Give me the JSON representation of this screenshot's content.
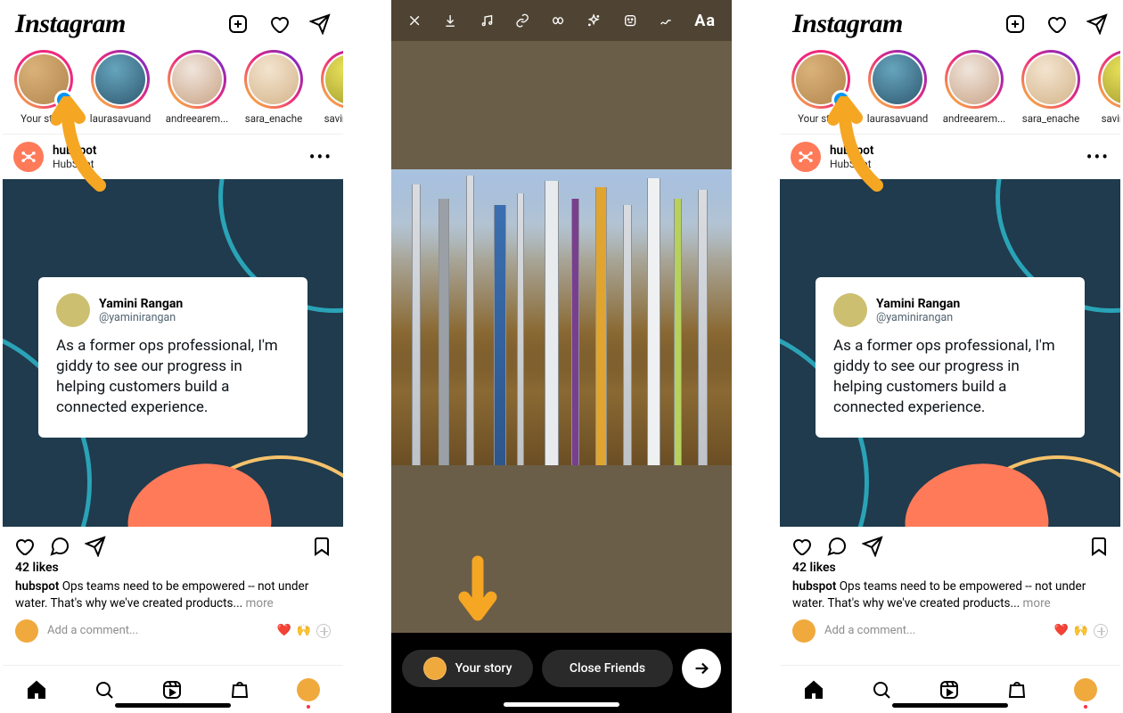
{
  "logo": "Instagram",
  "stories": [
    {
      "label": "Your story",
      "self": true
    },
    {
      "label": "laurasavuand"
    },
    {
      "label": "andreearem..."
    },
    {
      "label": "sara_enache"
    },
    {
      "label": "savinadrian"
    }
  ],
  "post": {
    "username": "hubspot",
    "display": "HubSpot",
    "likes": "42 likes",
    "caption_user": "hubspot",
    "caption_text": " Ops teams need to be empowered -- not under water. That's why we've created products...",
    "more": " more",
    "tweet": {
      "name": "Yamini Rangan",
      "handle": "@yaminirangan",
      "body": "As a former ops professional, I'm giddy to see our progress in helping customers build a connected experience."
    },
    "add_comment": "Add a comment...",
    "reacts": [
      "❤️",
      "🙌"
    ]
  },
  "editor": {
    "icons": [
      "close",
      "download",
      "music",
      "link",
      "infinity",
      "sparkle",
      "sticker",
      "scribble"
    ],
    "text_tool": "Aa",
    "share_your_story": "Your story",
    "share_close_friends": "Close Friends"
  }
}
